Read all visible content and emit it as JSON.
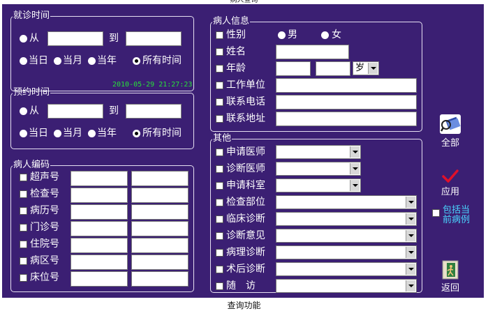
{
  "window": {
    "caption": "病人查询",
    "footer": "查询功能"
  },
  "visit_time": {
    "legend": "就诊时间",
    "from_label": "从",
    "to_label": "到",
    "from_value": "",
    "to_value": "",
    "ranges": [
      "当日",
      "当月",
      "当年",
      "所有时间"
    ],
    "selected_range": "所有时间",
    "timestamp": "2010-05-29 21:27:23"
  },
  "appointment_time": {
    "legend": "预约时间",
    "from_label": "从",
    "to_label": "到",
    "from_value": "",
    "to_value": "",
    "ranges": [
      "当日",
      "当月",
      "当年",
      "所有时间"
    ],
    "selected_range": "所有时间"
  },
  "patient_codes": {
    "legend": "病人编码",
    "items": [
      "超声号",
      "检查号",
      "病历号",
      "门诊号",
      "住院号",
      "病区号",
      "床位号"
    ]
  },
  "patient_info": {
    "legend": "病人信息",
    "gender_label": "性别",
    "male": "男",
    "female": "女",
    "name_label": "姓名",
    "age_label": "年龄",
    "age_unit": "岁",
    "employer_label": "工作单位",
    "phone_label": "联系电话",
    "address_label": "联系地址"
  },
  "other": {
    "legend": "其他",
    "items": [
      "申请医师",
      "诊断医师",
      "申请科室",
      "检查部位",
      "临床诊断",
      "诊断意见",
      "病理诊断",
      "术后诊断",
      "随　访"
    ]
  },
  "side": {
    "all_label": "全部",
    "apply_label": "应用",
    "include_current": "包括当前病例",
    "back_label": "返回"
  },
  "colors": {
    "panel_bg": "#3b1f73",
    "timestamp": "#27e03a",
    "apply_check": "#e0102a",
    "include_text": "#4ad6ff"
  }
}
